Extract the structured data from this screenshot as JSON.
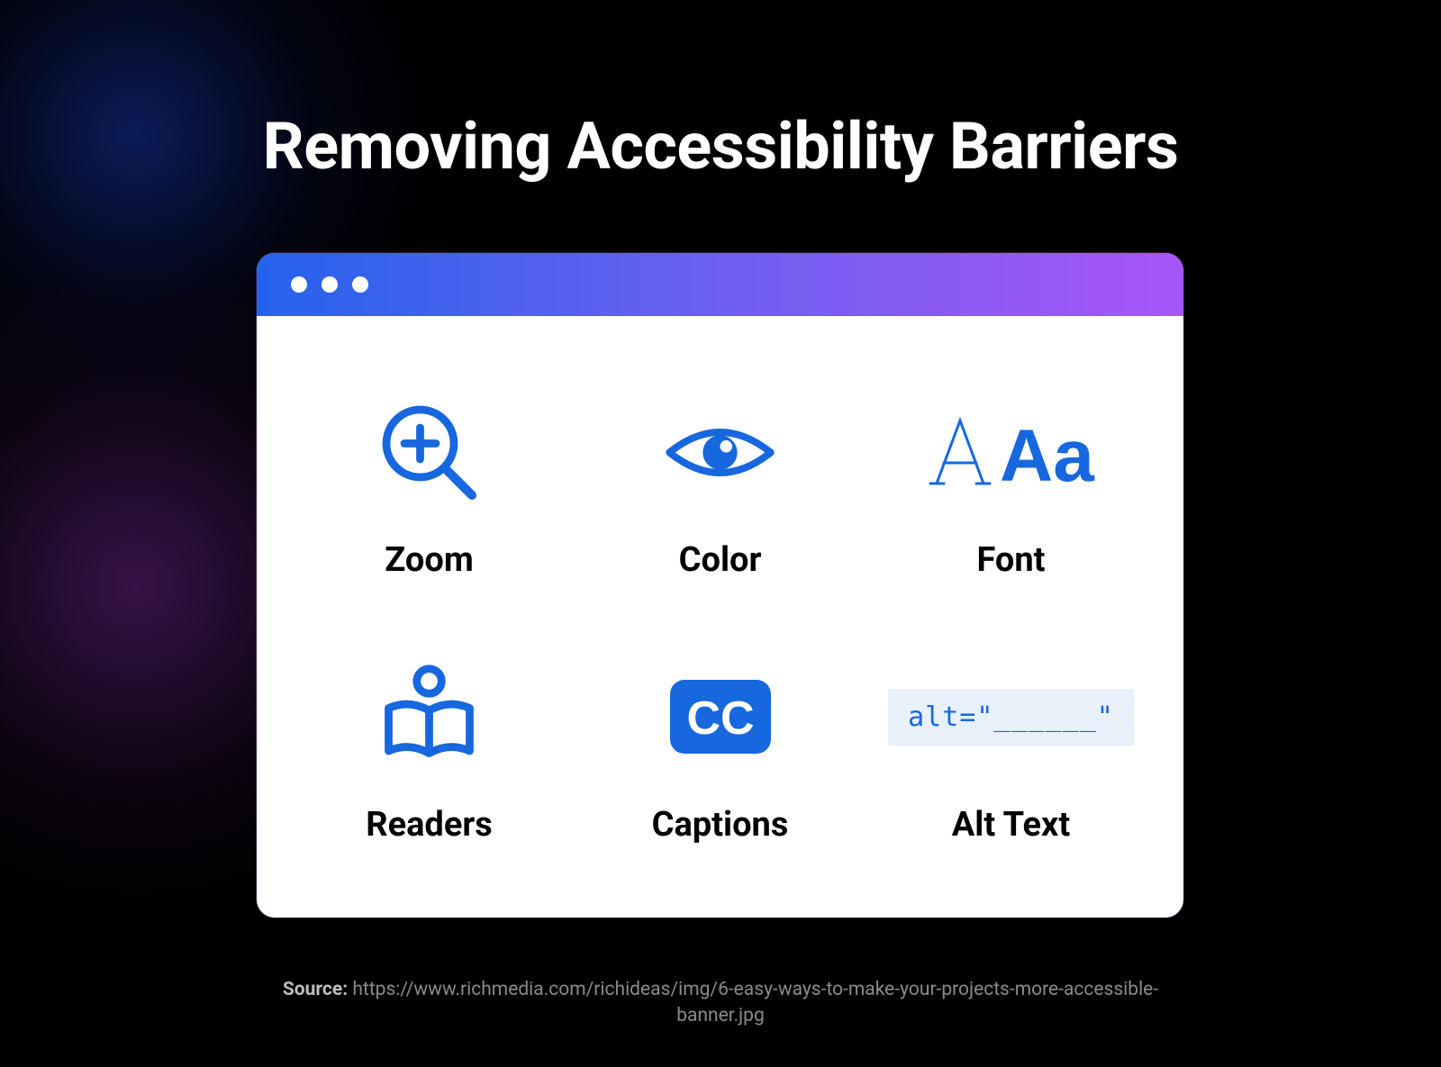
{
  "title": "Removing Accessibility Barriers",
  "cells": {
    "zoom": {
      "label": "Zoom",
      "icon": "zoom-in-icon"
    },
    "color": {
      "label": "Color",
      "icon": "eye-icon"
    },
    "font": {
      "label": "Font",
      "icon": "font-size-icon"
    },
    "readers": {
      "label": "Readers",
      "icon": "reader-icon"
    },
    "captions": {
      "label": "Captions",
      "icon": "closed-captions-icon"
    },
    "alttext": {
      "label": "Alt Text",
      "icon": "alt-text-icon",
      "alt_sample": "alt=\"______\""
    }
  },
  "source_prefix": "Source: ",
  "source_url": "https://www.richmedia.com/richideas/img/6-easy-ways-to-make-your-projects-more-accessible-banner.jpg",
  "colors": {
    "icon_blue": "#1767df"
  }
}
